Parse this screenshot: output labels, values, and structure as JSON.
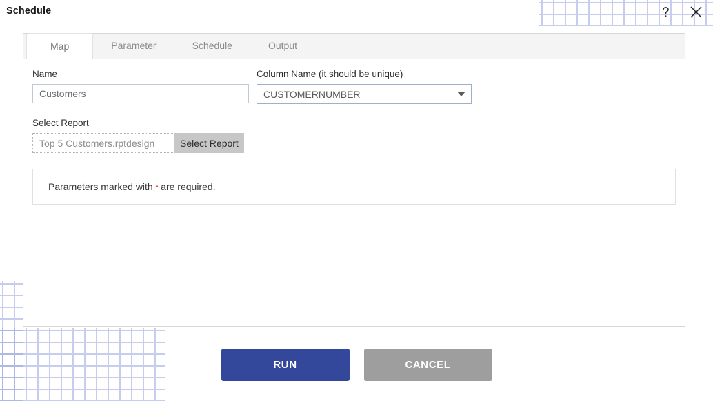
{
  "dialog": {
    "title": "Schedule",
    "help_icon": "question-mark-icon",
    "close_icon": "close-x-icon"
  },
  "tabs": [
    {
      "label": "Map",
      "active": true
    },
    {
      "label": "Parameter",
      "active": false
    },
    {
      "label": "Schedule",
      "active": false
    },
    {
      "label": "Output",
      "active": false
    }
  ],
  "form": {
    "name": {
      "label": "Name",
      "value": "Customers",
      "placeholder": "Customers"
    },
    "column_name": {
      "label": "Column Name (it should be unique)",
      "value": "CUSTOMERNUMBER",
      "options": [
        "CUSTOMERNUMBER"
      ],
      "caret_icon": "chevron-down-icon"
    },
    "select_report": {
      "label": "Select Report",
      "value": "Top 5 Customers.rptdesign",
      "placeholder": "Top 5 Customers.rptdesign",
      "button_label": "Select Report"
    },
    "notice": {
      "text_before": "Parameters marked with",
      "star": "*",
      "text_after": "are required."
    }
  },
  "footer": {
    "run_label": "RUN",
    "cancel_label": "CANCEL"
  },
  "colors": {
    "run_button": "#33479b",
    "cancel_button": "#9e9e9e",
    "required_star": "#e2342c",
    "pattern_dots": "#9aa7e0"
  }
}
